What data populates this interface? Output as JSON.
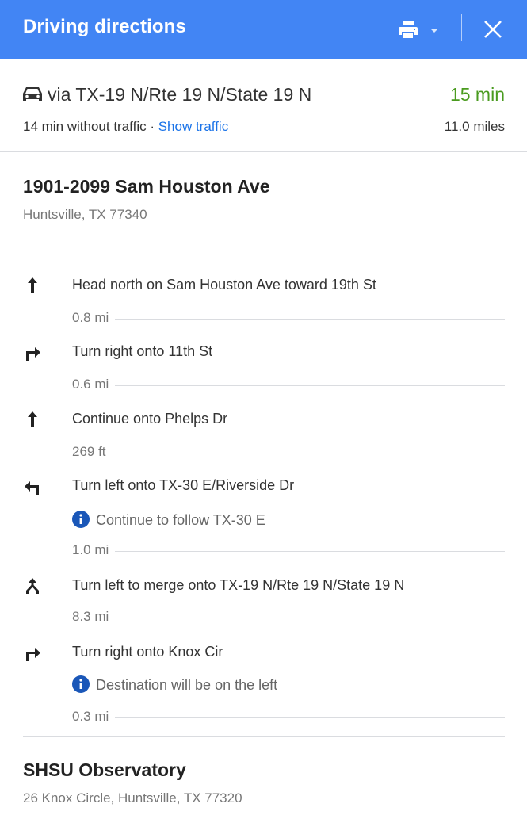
{
  "header": {
    "title": "Driving directions",
    "print_icon": "print-icon",
    "close_icon": "close-icon",
    "color": "#4285f4"
  },
  "summary": {
    "mode_icon": "car-icon",
    "via": "via TX-19 N/Rte 19 N/State 19 N",
    "duration": "15 min",
    "duration_color": "#4a9b1f",
    "without_traffic": "14 min without traffic · ",
    "show_traffic": "Show traffic",
    "distance": "11.0 miles"
  },
  "origin": {
    "name": "1901-2099 Sam Houston Ave",
    "address": "Huntsville, TX 77340"
  },
  "steps": [
    {
      "icon": "straight-arrow-icon",
      "text": "Head north on Sam Houston Ave toward 19th St",
      "distance": "0.8 mi"
    },
    {
      "icon": "turn-right-icon",
      "text": "Turn right onto 11th St",
      "distance": "0.6 mi"
    },
    {
      "icon": "straight-arrow-icon",
      "text": "Continue onto Phelps Dr",
      "distance": "269 ft"
    },
    {
      "icon": "turn-left-icon",
      "text": "Turn left onto TX-30 E/Riverside Dr",
      "note": "Continue to follow TX-30 E",
      "distance": "1.0 mi"
    },
    {
      "icon": "merge-icon",
      "text": "Turn left to merge onto TX-19 N/Rte 19 N/State 19 N",
      "distance": "8.3 mi"
    },
    {
      "icon": "turn-right-icon",
      "text": "Turn right onto Knox Cir",
      "note": "Destination will be on the left",
      "distance": "0.3 mi"
    }
  ],
  "destination": {
    "name": "SHSU Observatory",
    "address": "26 Knox Circle, Huntsville, TX 77320"
  }
}
